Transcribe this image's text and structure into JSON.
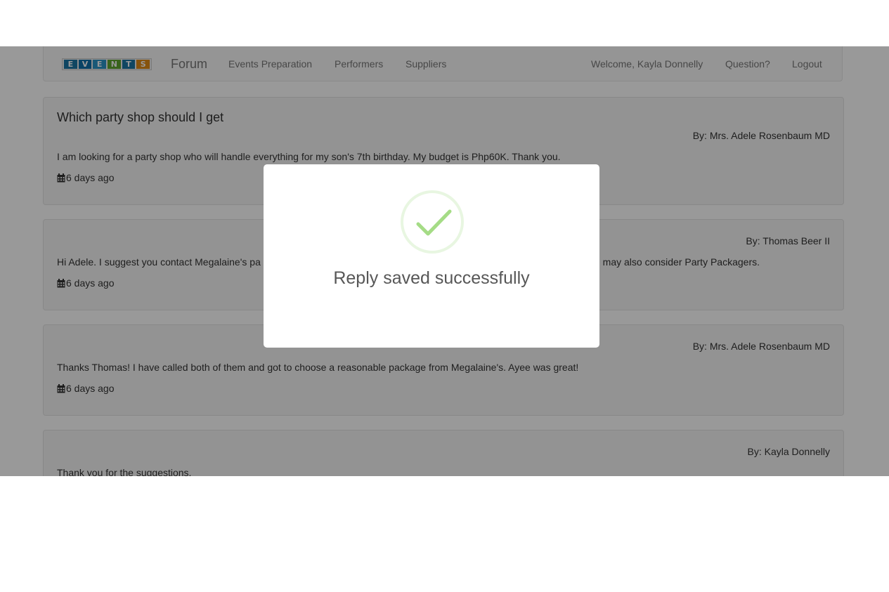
{
  "navbar": {
    "logo_letters": [
      "E",
      "V",
      "E",
      "N",
      "T",
      "S"
    ],
    "logo_colors": [
      "#1b75a3",
      "#0e6fa8",
      "#2b93c6",
      "#5fa52f",
      "#1b75a3",
      "#e08a14"
    ],
    "brand": "Forum",
    "links": [
      "Events Preparation",
      "Performers",
      "Suppliers"
    ],
    "welcome": "Welcome, Kayla Donnelly",
    "question": "Question?",
    "logout": "Logout"
  },
  "posts": [
    {
      "title": "Which party shop should I get",
      "author": "By: Mrs. Adele Rosenbaum MD",
      "body": "I am looking for a party shop who will handle everything for my son's 7th birthday. My budget is Php60K. Thank you.",
      "date": "6 days ago"
    },
    {
      "author": "By: Thomas Beer II",
      "body": "Hi Adele. I suggest you contact Megalaine's pa",
      "body_tail": "u may also consider Party Packagers.",
      "date": "6 days ago"
    },
    {
      "author": "By: Mrs. Adele Rosenbaum MD",
      "body": "Thanks Thomas! I have called both of them and got to choose a reasonable package from Megalaine's. Ayee was great!",
      "date": "6 days ago"
    },
    {
      "author": "By: Kayla Donnelly",
      "body": "Thank you for the suggestions."
    }
  ],
  "modal": {
    "title": "Reply saved successfully",
    "icon": "success-check-icon",
    "accent": "#a5dc86"
  }
}
